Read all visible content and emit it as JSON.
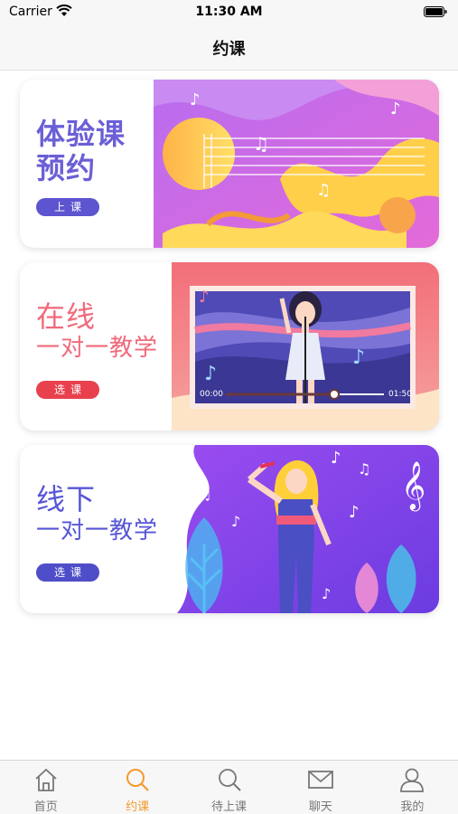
{
  "status_bar": {
    "carrier": "Carrier",
    "time": "11:30 AM"
  },
  "nav": {
    "title": "约课"
  },
  "cards": [
    {
      "title": "体验课",
      "subtitle": "预约",
      "button": "上课",
      "accent": "#6b5fd6"
    },
    {
      "title": "在线",
      "subtitle": "一对一教学",
      "button": "选课",
      "accent": "#f06a7c",
      "video": {
        "current_time": "00:00",
        "duration": "01:50"
      }
    },
    {
      "title": "线下",
      "subtitle": "一对一教学",
      "button": "选课",
      "accent": "#5656d6"
    }
  ],
  "tabs": [
    {
      "label": "首页",
      "icon": "home-icon",
      "active": false
    },
    {
      "label": "约课",
      "icon": "search-icon",
      "active": true
    },
    {
      "label": "待上课",
      "icon": "search-icon",
      "active": false
    },
    {
      "label": "聊天",
      "icon": "mail-icon",
      "active": false
    },
    {
      "label": "我的",
      "icon": "user-icon",
      "active": false
    }
  ],
  "colors": {
    "active_tab": "#f39a2c",
    "inactive_tab": "#777777"
  }
}
